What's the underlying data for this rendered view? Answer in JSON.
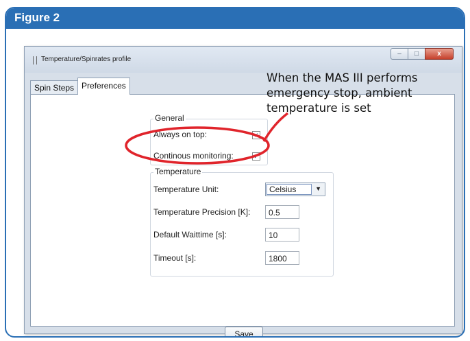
{
  "figure": {
    "title": "Figure 2"
  },
  "window": {
    "title": "Temperature/Spinrates profile",
    "controls": {
      "minimize": "–",
      "maximize": "□",
      "close": "x"
    }
  },
  "tabs": [
    {
      "label": "Spin Steps",
      "active": false
    },
    {
      "label": "Preferences",
      "active": true
    }
  ],
  "general": {
    "title": "General",
    "always_on_top": {
      "label": "Always on top:",
      "checked": true,
      "mark": "✓"
    },
    "continuous_monitoring": {
      "label": "Continous monitoring:",
      "checked": true,
      "mark": "✓"
    }
  },
  "temperature": {
    "title": "Temperature",
    "unit": {
      "label": "Temperature Unit:",
      "value": "Celsius",
      "arrow": "▼"
    },
    "precision": {
      "label": "Temperature Precision [K]:",
      "value": "0.5"
    },
    "waittime": {
      "label": "Default Waittime [s]:",
      "value": "10"
    },
    "timeout": {
      "label": "Timeout [s]:",
      "value": "1800"
    }
  },
  "save_label": "Save",
  "callout": {
    "line1": "When the MAS III performs",
    "line2": "emergency stop, ambient",
    "line3": "temperature is set",
    "color": "#e0242b"
  },
  "colors": {
    "figure_accent": "#2a6fb5",
    "highlight": "#e0242b"
  }
}
